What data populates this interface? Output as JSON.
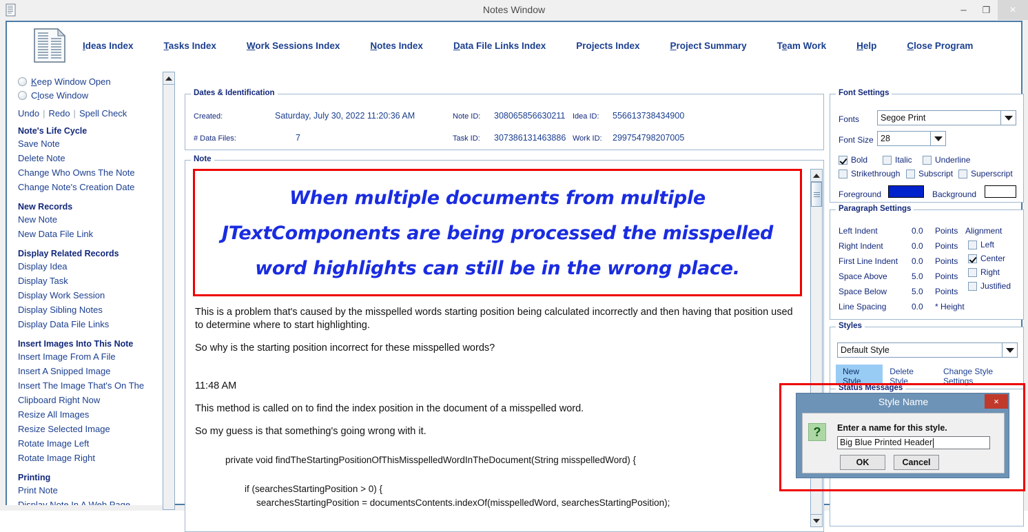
{
  "window": {
    "title": "Notes Window",
    "minimize_label": "–",
    "maximize_label": "❐",
    "close_label": "×"
  },
  "menu": {
    "items": [
      {
        "pre": "",
        "mn": "I",
        "post": "deas Index"
      },
      {
        "pre": "",
        "mn": "T",
        "post": "asks Index"
      },
      {
        "pre": "",
        "mn": "W",
        "post": "ork Sessions Index"
      },
      {
        "pre": "",
        "mn": "N",
        "post": "otes Index"
      },
      {
        "pre": "",
        "mn": "D",
        "post": "ata File Links Index"
      },
      {
        "pre": "Projects Index",
        "mn": "",
        "post": ""
      },
      {
        "pre": "",
        "mn": "P",
        "post": "roject Summary"
      },
      {
        "pre": "T",
        "mn": "e",
        "post": "am Work"
      },
      {
        "pre": "",
        "mn": "H",
        "post": "elp"
      },
      {
        "pre": "",
        "mn": "C",
        "post": "lose Program"
      }
    ]
  },
  "sidebar": {
    "radios": [
      {
        "pre": "",
        "mn": "K",
        "post": "eep Window Open"
      },
      {
        "pre": "C",
        "mn": "l",
        "post": "ose Window"
      }
    ],
    "tools": [
      "Undo",
      "Redo",
      "Spell Check"
    ],
    "sections": [
      {
        "heading": "Note's Life Cycle",
        "links": [
          "Save Note",
          "Delete Note",
          "Change Who Owns The Note",
          "Change Note's Creation Date"
        ]
      },
      {
        "heading": "New Records",
        "links": [
          "New Note",
          "New Data File Link"
        ]
      },
      {
        "heading": "Display Related Records",
        "links": [
          "Display Idea",
          "Display Task",
          "Display Work Session",
          "Display Sibling Notes",
          "Display Data File Links"
        ]
      },
      {
        "heading": "Insert Images Into This Note",
        "links": [
          "Insert Image From A File",
          "Insert A Snipped Image",
          "Insert The Image That's On The Clipboard Right Now",
          "Resize All Images",
          "Resize Selected Image",
          "Rotate Image Left",
          "Rotate Image Right"
        ]
      },
      {
        "heading": "Printing",
        "links": [
          "Print Note",
          "Display Note In A Web Page"
        ]
      }
    ]
  },
  "dates": {
    "group_title": "Dates & Identification",
    "created_label": "Created:",
    "created_value": "Saturday, July 30, 2022  11:20:36 AM",
    "datafiles_label": "# Data Files:",
    "datafiles_value": "7",
    "note_id_label": "Note ID:",
    "note_id_value": "308065856630211",
    "idea_id_label": "Idea ID:",
    "idea_id_value": "556613738434900",
    "task_id_label": "Task ID:",
    "task_id_value": "307386131463886",
    "work_id_label": "Work ID:",
    "work_id_value": "299754798207005"
  },
  "note": {
    "group_title": "Note",
    "header_text": "When multiple documents from multiple JTextComponents are being processed the misspelled word highlights can still be in the wrong place.",
    "paragraphs": [
      "This is a problem that's caused by the misspelled words starting position being calculated incorrectly and then having that position used to determine where to start highlighting.",
      "So why is the starting position incorrect for these misspelled words?"
    ],
    "timestamp": "11:48 AM",
    "paragraphs2": [
      "This method is called on to find the index position in the document of a misspelled word.",
      "So my guess is that something's going wrong with it."
    ],
    "code_lines": [
      "private void findTheStartingPositionOfThisMisspelledWordInTheDocument(String misspelledWord) {",
      "if (searchesStartingPosition > 0) {",
      "searchesStartingPosition = documentsContents.indexOf(misspelledWord, searchesStartingPosition);"
    ]
  },
  "font_settings": {
    "group_title": "Font Settings",
    "fonts_label": "Fonts",
    "fonts_value": "Segoe Print",
    "size_label": "Font Size",
    "size_value": "28",
    "checkboxes": [
      {
        "label": "Bold",
        "checked": true
      },
      {
        "label": "Italic",
        "checked": false
      },
      {
        "label": "Underline",
        "checked": false
      },
      {
        "label": "Strikethrough",
        "checked": false
      },
      {
        "label": "Subscript",
        "checked": false
      },
      {
        "label": "Superscript",
        "checked": false
      }
    ],
    "foreground_label": "Foreground",
    "foreground_color": "#0022CC",
    "background_label": "Background",
    "background_color": "#FFFFFF"
  },
  "paragraph_settings": {
    "group_title": "Paragraph Settings",
    "rows": [
      {
        "label": "Left Indent",
        "value": "0.0",
        "unit": "Points"
      },
      {
        "label": "Right Indent",
        "value": "0.0",
        "unit": "Points"
      },
      {
        "label": "First Line Indent",
        "value": "0.0",
        "unit": "Points"
      },
      {
        "label": "Space Above",
        "value": "5.0",
        "unit": "Points"
      },
      {
        "label": "Space Below",
        "value": "5.0",
        "unit": "Points"
      },
      {
        "label": "Line Spacing",
        "value": "0.0",
        "unit": "* Height"
      }
    ],
    "alignment_label": "Alignment",
    "alignment_options": [
      {
        "label": "Left",
        "checked": false
      },
      {
        "label": "Center",
        "checked": true
      },
      {
        "label": "Right",
        "checked": false
      },
      {
        "label": "Justified",
        "checked": false
      }
    ]
  },
  "styles": {
    "group_title": "Styles",
    "selected": "Default Style",
    "buttons": [
      {
        "label": "New Style",
        "selected": true
      },
      {
        "label": "Delete Style",
        "selected": false
      },
      {
        "label": "Change Style Settings",
        "selected": false
      }
    ]
  },
  "status": {
    "group_title": "Status Messages"
  },
  "dialog": {
    "title": "Style Name",
    "close_label": "×",
    "icon": "?",
    "prompt": "Enter a name for this style.",
    "input_value": "Big Blue Printed Header",
    "ok_label": "OK",
    "cancel_label": "Cancel"
  }
}
